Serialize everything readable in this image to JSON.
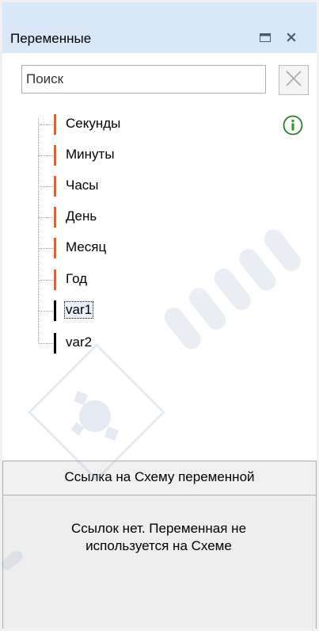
{
  "panel": {
    "title": "Переменные",
    "maximize_icon": "maximize-icon",
    "close_icon": "close-icon"
  },
  "search": {
    "placeholder": "Поиск",
    "value": "",
    "clear_icon": "clear-x-icon"
  },
  "info_icon": "info-icon",
  "variables": [
    {
      "label": "Секунды",
      "marker_color": "#f05a24",
      "selected": false
    },
    {
      "label": "Минуты",
      "marker_color": "#f05a24",
      "selected": false
    },
    {
      "label": "Часы",
      "marker_color": "#f05a24",
      "selected": false
    },
    {
      "label": "День",
      "marker_color": "#f05a24",
      "selected": false
    },
    {
      "label": "Месяц",
      "marker_color": "#f05a24",
      "selected": false
    },
    {
      "label": "Год",
      "marker_color": "#f05a24",
      "selected": false
    },
    {
      "label": "var1",
      "marker_color": "#000000",
      "selected": true
    },
    {
      "label": "var2",
      "marker_color": "#000000",
      "selected": false
    }
  ],
  "reference": {
    "header": "Ссылка на Схему переменной",
    "message_line1": "Ссылок нет. Переменная не",
    "message_line2": "используется на Схеме"
  },
  "colors": {
    "titlebar_bg": "#d9e8f6",
    "builtin_marker": "#f05a24",
    "user_marker": "#000000",
    "info_icon_green": "#2e9b2e",
    "watermark": "#9fb5d6"
  }
}
